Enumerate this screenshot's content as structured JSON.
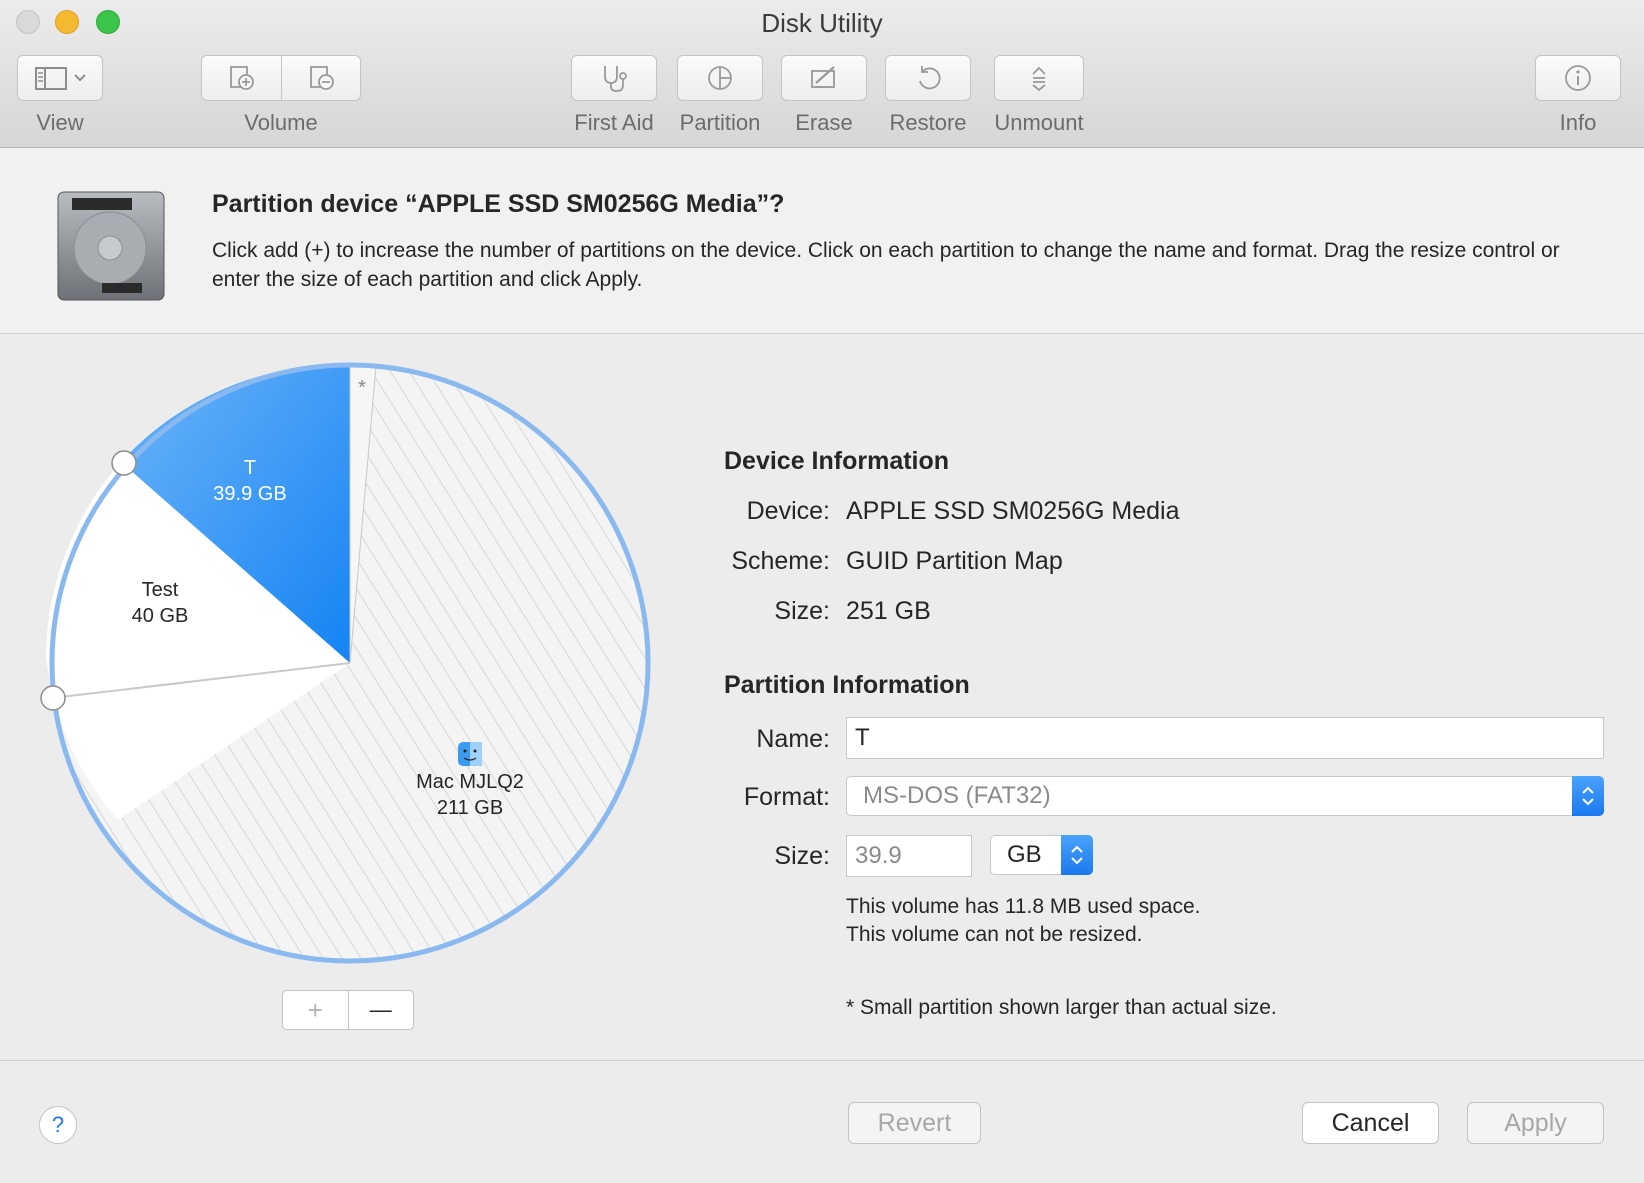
{
  "window": {
    "title": "Disk Utility"
  },
  "toolbar": {
    "view_label": "View",
    "volume_label": "Volume",
    "first_aid_label": "First Aid",
    "partition_label": "Partition",
    "erase_label": "Erase",
    "restore_label": "Restore",
    "unmount_label": "Unmount",
    "info_label": "Info"
  },
  "header": {
    "title": "Partition device “APPLE SSD SM0256G Media”?",
    "description": "Click add (+) to increase the number of partitions on the device. Click on each partition to change the name and format. Drag the resize control or enter the size of each partition and click Apply."
  },
  "pie": {
    "slices": [
      {
        "name": "T",
        "size": "39.9 GB",
        "color": "#1f8af5"
      },
      {
        "name": "Test",
        "size": "40 GB",
        "color": "#ffffff"
      },
      {
        "name": "Mac MJLQ2",
        "size": "211 GB",
        "color": "#f2f2f2"
      }
    ],
    "small_marker": "*",
    "add_symbol": "+",
    "remove_symbol": "—"
  },
  "device_info": {
    "heading": "Device Information",
    "device_label": "Device:",
    "device_value": "APPLE SSD SM0256G Media",
    "scheme_label": "Scheme:",
    "scheme_value": "GUID Partition Map",
    "size_label": "Size:",
    "size_value": "251 GB"
  },
  "partition_info": {
    "heading": "Partition Information",
    "name_label": "Name:",
    "name_value": "T",
    "format_label": "Format:",
    "format_value": "MS-DOS (FAT32)",
    "size_label": "Size:",
    "size_value": "39.9",
    "unit_value": "GB",
    "used_note": "This volume has 11.8 MB used space.",
    "resize_note": "This volume can not be resized.",
    "small_note": "* Small partition shown larger than actual size."
  },
  "footer": {
    "help_symbol": "?",
    "revert_label": "Revert",
    "cancel_label": "Cancel",
    "apply_label": "Apply"
  },
  "colors": {
    "accent": "#1a78ef",
    "pie_rim": "#8ab9ef"
  }
}
